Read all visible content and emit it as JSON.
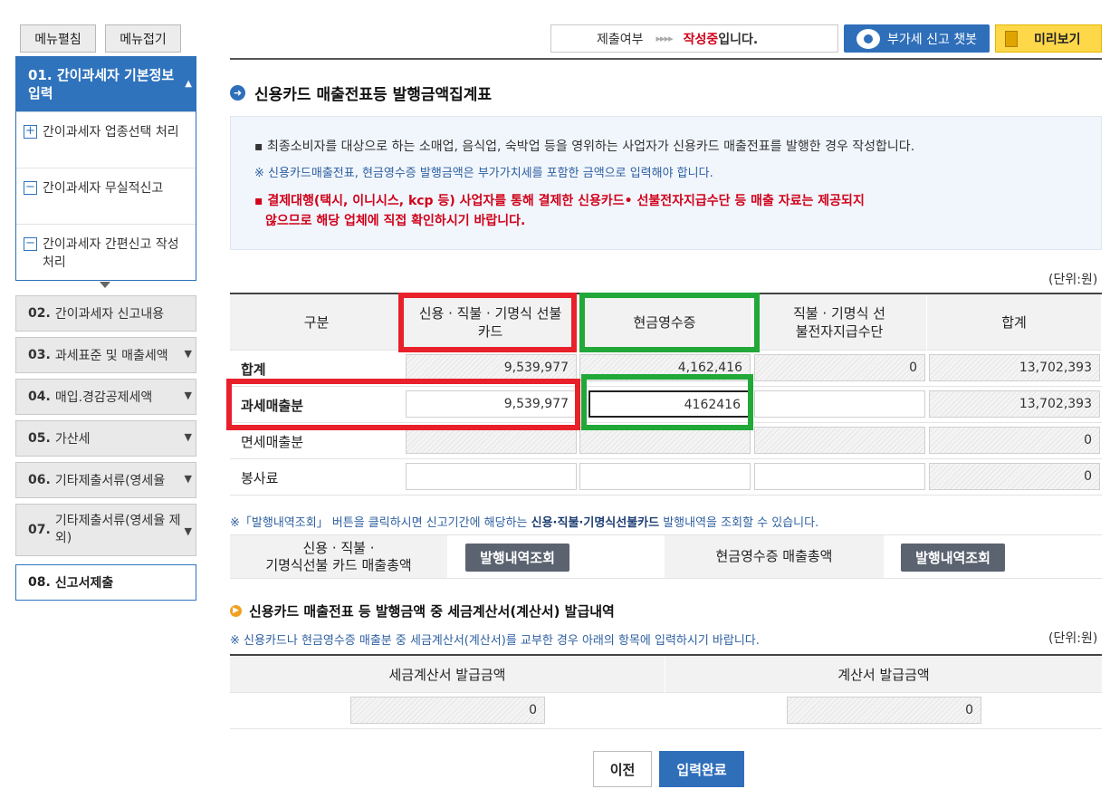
{
  "sidebar": {
    "expand_label": "메뉴펼침",
    "collapse_label": "메뉴접기",
    "steps": [
      {
        "num": "01.",
        "label": "간이과세자 기본정보 입력"
      },
      {
        "num": "02.",
        "label": "간이과세자 신고내용"
      },
      {
        "num": "03.",
        "label": "과세표준 및 매출세액"
      },
      {
        "num": "04.",
        "label": "매입.경감공제세액"
      },
      {
        "num": "05.",
        "label": "가산세"
      },
      {
        "num": "06.",
        "label": "기타제출서류(영세율"
      },
      {
        "num": "07.",
        "label": "기타제출서류(영세율 제외)"
      },
      {
        "num": "08.",
        "label": "신고서제출"
      }
    ],
    "sub_items": [
      {
        "box": "+",
        "label": "간이과세자 업종선택 처리"
      },
      {
        "box": "−",
        "label": "간이과세자 무실적신고"
      },
      {
        "box": "−",
        "label": "간이과세자 간편신고 작성 처리"
      }
    ]
  },
  "topbar": {
    "status_label": "제출여부",
    "status_arrows": "▸▸▸▸",
    "status_value": "작성중",
    "status_suffix": "입니다.",
    "chatbot_label": "부가세 신고 챗봇",
    "preview_label": "미리보기"
  },
  "page_title": "신용카드 매출전표등 발행금액집계표",
  "notice": {
    "line1": "▪ 최종소비자를 대상으로 하는 소매업, 음식업, 숙박업 등을 영위하는 사업자가 신용카드 매출전표를 발행한 경우 작성합니다.",
    "line2": "※ 신용카드매출전표, 현금영수증 발행금액은 부가가치세를 포함한 금액으로 입력해야 합니다.",
    "line3a": "▪ 결제대행(택시, 이니시스, kcp 등) 사업자를 통해 결제한 신용카드• 선불전자지급수단 등 매출 자료는 제공되지",
    "line3b": "않으므로 해당 업체에 직접 확인하시기 바랍니다."
  },
  "unit_label": "(단위:원)",
  "table": {
    "headers": [
      "구분",
      "신용 · 직불 · 기명식 선불카드",
      "현금영수증",
      "직불 · 기명식 선불전자지급수단",
      "합계"
    ],
    "rows": [
      {
        "label": "합계",
        "card": "9,539,977",
        "cash": "4,162,416",
        "prepaid": "0",
        "total": "13,702,393"
      },
      {
        "label": "과세매출분",
        "card": "9,539,977",
        "cash": "4162416",
        "prepaid": "",
        "total": "13,702,393"
      },
      {
        "label": "면세매출분",
        "card": "",
        "cash": "",
        "prepaid": "",
        "total": "0"
      },
      {
        "label": "봉사료",
        "card": "",
        "cash": "",
        "prepaid": "",
        "total": "0"
      }
    ]
  },
  "lookup_note": {
    "prefix": "※「발행내역조회」 버튼을 클릭하시면 신고기간에 해당하는 ",
    "bold": "신용·직불·기명식선불카드",
    "suffix": " 발행내역을 조회할 수 있습니다."
  },
  "lookup": {
    "card_label_1": "신용 · 직불 ·",
    "card_label_2": "기명식선불 카드 매출총액",
    "cash_label": "현금영수증 매출총액",
    "btn_label": "발행내역조회"
  },
  "section2": {
    "title": "신용카드 매출전표 등 발행금액 중 세금계산서(계산서) 발급내역",
    "note": "※ 신용카드나 현금영수증 매출분 중 세금계산서(계산서)를 교부한 경우 아래의 항목에 입력하시기 바랍니다.",
    "unit": "(단위:원)",
    "headers": [
      "세금계산서 발급금액",
      "계산서 발급금액"
    ],
    "values": [
      "0",
      "0"
    ]
  },
  "footer": {
    "prev_label": "이전",
    "done_label": "입력완료"
  },
  "colors": {
    "accent": "#2f6fba",
    "highlight_red": "#e8202a",
    "highlight_green": "#21a838",
    "warning": "#d0021b"
  }
}
